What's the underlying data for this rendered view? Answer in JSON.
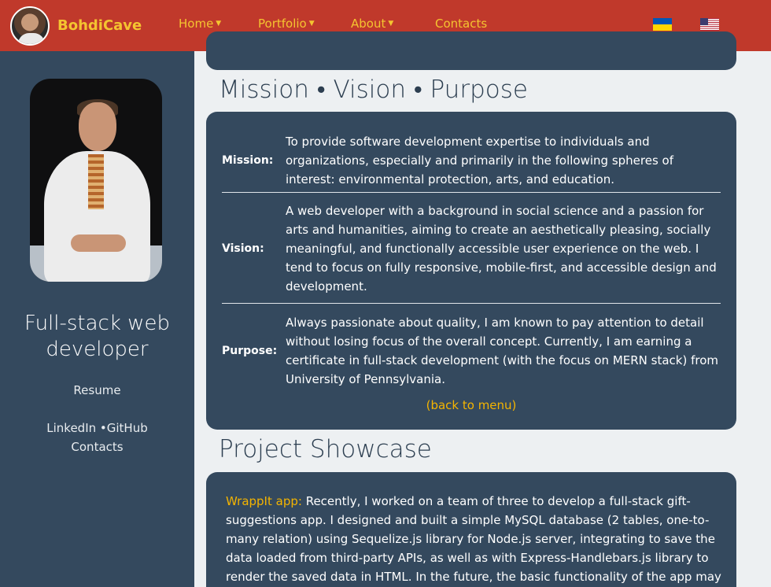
{
  "brand": {
    "name": "BohdiCave",
    "avatar_icon": "profile-photo"
  },
  "nav": {
    "items": [
      {
        "label": "Home",
        "has_dropdown": true
      },
      {
        "label": "Portfolio",
        "has_dropdown": true
      },
      {
        "label": "About",
        "has_dropdown": true
      },
      {
        "label": "Contacts",
        "has_dropdown": false
      }
    ],
    "caret": "▼",
    "languages": [
      "ukraine-flag-icon",
      "us-flag-icon"
    ]
  },
  "sidebar": {
    "title": "Full-stack web developer",
    "resume": "Resume",
    "links": "LinkedIn •GitHub",
    "contacts": "Contacts"
  },
  "sections": {
    "mvp_title": "Mission • Vision • Purpose",
    "mvp": [
      {
        "label": "Mission:",
        "text": "To provide software development expertise to individuals and organizations, especially and primarily in the following spheres of interest: environmental protection, arts, and education."
      },
      {
        "label": "Vision:",
        "text": "A web developer with a background in social science and a passion for arts and humanities, aiming to create an aesthetically pleasing, socially meaningful, and functionally accessible user experience on the web. I tend to focus on fully responsive, mobile-first, and accessible design and development."
      },
      {
        "label": "Purpose:",
        "text": "Always passionate about quality, I am known to pay attention to detail without losing focus of the overall concept. Currently, I am earning a certificate in full-stack development (with the focus on MERN stack) from University of Pennsylvania."
      }
    ],
    "back_link": "(back to menu)",
    "project_title": "Project Showcase",
    "project": {
      "link": "WrappIt app:",
      "text": " Recently, I worked on a team of three to develop a full-stack gift-suggestions app. I designed and built a simple MySQL database (2 tables, one-to-many relation) using Sequelize.js library for Node.js server, integrating to save the data loaded from third-party APIs, as well as with Express-Handlebars.js library to render the saved data in HTML. In the future, the basic functionality of the app may be expanded to"
    }
  },
  "colors": {
    "navbar": "#c0392b",
    "accent": "#f4c430",
    "card": "#34495e",
    "link": "#f4b400"
  }
}
